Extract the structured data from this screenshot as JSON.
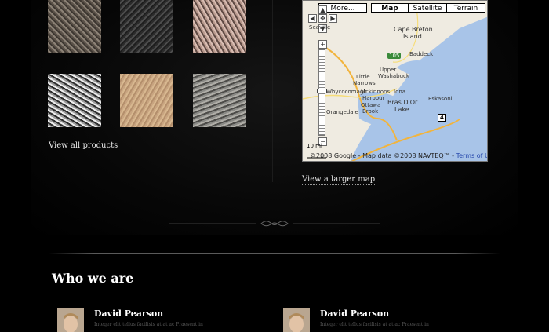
{
  "products": {
    "view_all_label": "View all products"
  },
  "map": {
    "types": [
      "More...",
      "Map",
      "Satellite",
      "Terrain"
    ],
    "labels": {
      "cape_breton": "Cape Breton",
      "island": "Island",
      "baddeck": "Baddeck",
      "upper": "Upper",
      "washabuck": "Washabuck",
      "little": "Little",
      "narrows": "Narrows",
      "whycocomagh": "Whycocomagh",
      "mckinnons": "Mckinnons",
      "harbour": "Harbour",
      "iona": "Iona",
      "bras_dor": "Bras D'Or",
      "lake": "Lake",
      "eskasoni": "Eskasoni",
      "orangedale": "Orangedale",
      "ottawa": "Ottawa",
      "brook": "Brook",
      "route_4": "4",
      "route_105": "105",
      "scale": "10 mi",
      "seaville": "Seaville"
    },
    "copyright": "©2008 Google - Map data ©2008 NAVTEQ™ -",
    "terms": "Terms of Use",
    "larger_map_label": "View a larger map"
  },
  "about": {
    "heading": "Who we are",
    "people": [
      {
        "name": "David Pearson",
        "blurb": "Integer elit tellus facilisis at at ac Praesent in"
      },
      {
        "name": "David Pearson",
        "blurb": "Integer elit tellus facilisis at at ac Praesent in"
      }
    ]
  }
}
